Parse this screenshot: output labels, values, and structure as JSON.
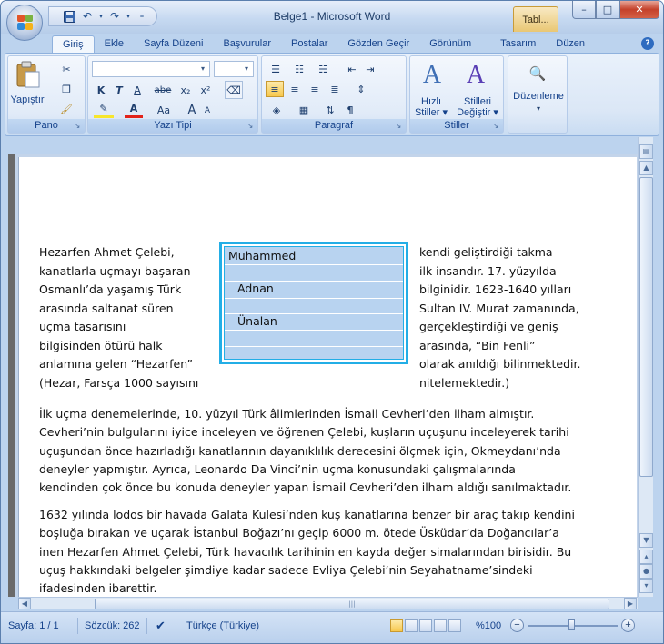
{
  "window": {
    "title": "Belge1 - Microsoft Word",
    "context_tab": "Tabl...",
    "minimize": "–",
    "maximize": "□",
    "close": "✕"
  },
  "qat": {
    "save_icon": "save-icon",
    "undo_icon": "undo-icon",
    "redo_icon": "redo-icon"
  },
  "tabs": [
    {
      "label": "Giriş",
      "active": true
    },
    {
      "label": "Ekle"
    },
    {
      "label": "Sayfa Düzeni"
    },
    {
      "label": "Başvurular"
    },
    {
      "label": "Postalar"
    },
    {
      "label": "Gözden Geçir"
    },
    {
      "label": "Görünüm"
    },
    {
      "label": "Tasarım"
    },
    {
      "label": "Düzen"
    }
  ],
  "help": "?",
  "ribbon": {
    "clipboard": {
      "label": "Pano",
      "paste_label": "Yapıştır"
    },
    "font": {
      "label": "Yazı Tipi",
      "font_name": "",
      "font_size": "",
      "bold": "K",
      "italic": "T",
      "underline": "A",
      "strike": "abe",
      "subscript": "x₂",
      "superscript": "x²",
      "case": "Aa",
      "grow": "A",
      "shrink": "A"
    },
    "paragraph": {
      "label": "Paragraf",
      "pilcrow": "¶"
    },
    "styles": {
      "label": "Stiller",
      "quick_styles": [
        "Hızlı",
        "Stiller ▾"
      ],
      "change_styles": [
        "Stilleri",
        "Değiştir ▾"
      ]
    },
    "editing": {
      "label": "Düzenleme"
    }
  },
  "document": {
    "left_column": [
      "Hezarfen Ahmet Çelebi,",
      "kanatlarla uçmayı başaran",
      "Osmanlı’da yaşamış Türk",
      "arasında saltanat süren",
      "uçma tasarısını",
      "bilgisinden ötürü halk",
      "anlamına gelen “Hezarfen”",
      "(Hezar, Farsça 1000 sayısını"
    ],
    "right_column": [
      "kendi geliştirdiği takma",
      "ilk insandır. 17. yüzyılda",
      "bilginidir. 1623-1640 yılları",
      "Sultan IV. Murat zamanında,",
      "gerçekleştirdiği ve geniş",
      "arasında, “Bin Fenli”",
      "olarak anıldığı bilinmektedir.",
      "nitelemektedir.)"
    ],
    "textbox_words": [
      "Muhammed",
      "Adnan",
      "Ünalan"
    ],
    "paragraph1": [
      "İlk uçma denemelerinde, 10. yüzyıl Türk âlimlerinden İsmail Cevheri’den ilham almıştır.",
      "Cevheri’nin bulgularını iyice inceleyen ve öğrenen Çelebi, kuşların uçuşunu  inceleyerek tarihi",
      "uçuşundan  önce hazırladığı kanatlarının dayanıklılık derecesini ölçmek için, Okmeydanı’nda",
      "deneyler yapmıştır. Ayrıca, Leonardo Da Vinci’nin uçma konusundaki  çalışmalarında",
      "kendinden çok önce bu konuda  deneyler yapan İsmail Cevheri’den ilham aldığı sanılmaktadır."
    ],
    "paragraph2": [
      "1632 yılında lodos bir havada Galata Kulesi’nden kuş kanatlarına benzer bir araç takıp kendini",
      "boşluğa bırakan ve uçarak İstanbul  Boğazı’nı geçip 6000 m. ötede Üsküdar’da  Doğancılar’a",
      "inen Hezarfen Ahmet  Çelebi, Türk havacılık tarihinin en kayda değer simalarından birisidir. Bu",
      "uçuş hakkındaki  belgeler şimdiye kadar sadece Evliya Çelebi’nin Seyahatname’sindeki",
      "ifadesinden ibarettir."
    ]
  },
  "statusbar": {
    "page": "Sayfa: 1 / 1",
    "words": "Sözcük: 262",
    "language": "Türkçe (Türkiye)",
    "zoom": "%100"
  },
  "colors": {
    "textbox_border": "#23aee6",
    "textbox_fill": "#b8d3f0",
    "ribbon_text": "#15428b"
  }
}
